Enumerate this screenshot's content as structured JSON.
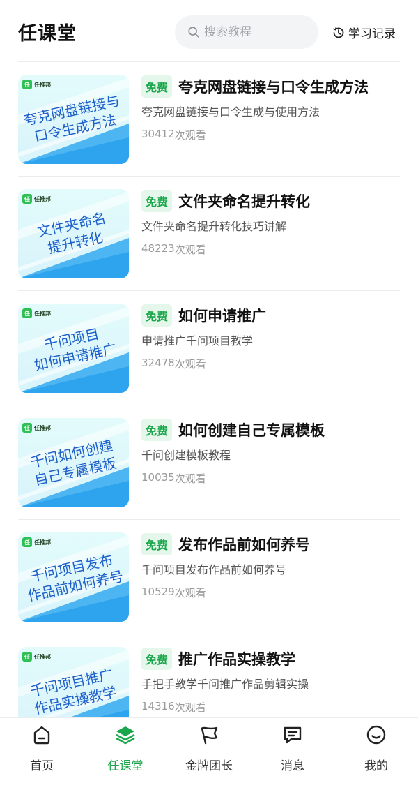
{
  "header": {
    "title": "任课堂",
    "search_placeholder": "搜索教程",
    "history_label": "学习记录"
  },
  "courses": [
    {
      "thumb_logo": "任推邦",
      "thumb_title": "夸克网盘链接与\n口令生成方法",
      "badge": "免费",
      "title": "夸克网盘链接与口令生成方法",
      "desc": "夸克网盘链接与口令生成与使用方法",
      "views": "30412",
      "views_suffix": "次观看"
    },
    {
      "thumb_logo": "任推邦",
      "thumb_title": "文件夹命名\n提升转化",
      "badge": "免费",
      "title": "文件夹命名提升转化",
      "desc": "文件夹命名提升转化技巧讲解",
      "views": "48223",
      "views_suffix": "次观看"
    },
    {
      "thumb_logo": "任推邦",
      "thumb_title": "千问项目\n如何申请推广",
      "badge": "免费",
      "title": "如何申请推广",
      "desc": "申请推广千问项目教学",
      "views": "32478",
      "views_suffix": "次观看"
    },
    {
      "thumb_logo": "任推邦",
      "thumb_title": "千问如何创建\n自己专属模板",
      "badge": "免费",
      "title": "如何创建自己专属模板",
      "desc": "千问创建模板教程",
      "views": "10035",
      "views_suffix": "次观看"
    },
    {
      "thumb_logo": "任推邦",
      "thumb_title": "千问项目发布\n作品前如何养号",
      "badge": "免费",
      "title": "发布作品前如何养号",
      "desc": "千问项目发布作品前如何养号",
      "views": "10529",
      "views_suffix": "次观看"
    },
    {
      "thumb_logo": "任推邦",
      "thumb_title": "千问项目推广\n作品实操教学",
      "badge": "免费",
      "title": "推广作品实操教学",
      "desc": "手把手教学千问推广作品剪辑实操",
      "views": "14316",
      "views_suffix": "次观看"
    }
  ],
  "tabs": [
    {
      "label": "首页",
      "icon": "home-icon",
      "active": false
    },
    {
      "label": "任课堂",
      "icon": "stack-icon",
      "active": true
    },
    {
      "label": "金牌团长",
      "icon": "flag-icon",
      "active": false
    },
    {
      "label": "消息",
      "icon": "message-icon",
      "active": false
    },
    {
      "label": "我的",
      "icon": "smile-icon",
      "active": false
    }
  ],
  "colors": {
    "accent": "#1aa64a",
    "badge_bg": "#e4f7ea",
    "thumb_text": "#1d5fc9"
  }
}
